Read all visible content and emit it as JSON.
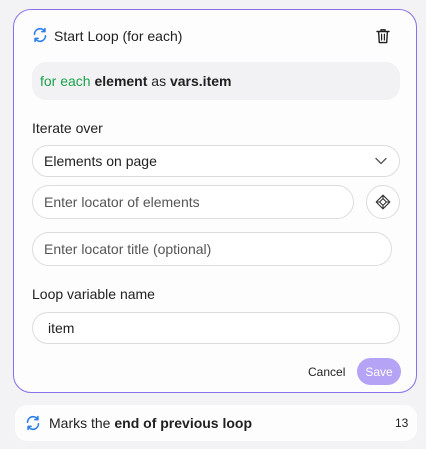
{
  "step": {
    "title": "Start Loop (for each)",
    "summary": {
      "kw1": "for each",
      "kw2": "element",
      "kw3": "as",
      "kw4": "vars.item"
    }
  },
  "iterate": {
    "label": "Iterate over",
    "selected": "Elements on page",
    "locator_placeholder": "Enter locator of elements",
    "title_placeholder": "Enter locator title (optional)"
  },
  "variable": {
    "label": "Loop variable name",
    "value": "item"
  },
  "actions": {
    "cancel": "Cancel",
    "save": "Save"
  },
  "next_step": {
    "prefix": "Marks the",
    "bold": "end of previous loop",
    "number": "13"
  },
  "colors": {
    "accent": "#8a70e8",
    "save_bg": "#b5a3f5",
    "keyword_green": "#1aa34a",
    "loop_icon": "#2b7de9"
  },
  "icons": [
    "loop-icon",
    "trash-icon",
    "chevron-down-icon",
    "locator-picker-icon"
  ]
}
